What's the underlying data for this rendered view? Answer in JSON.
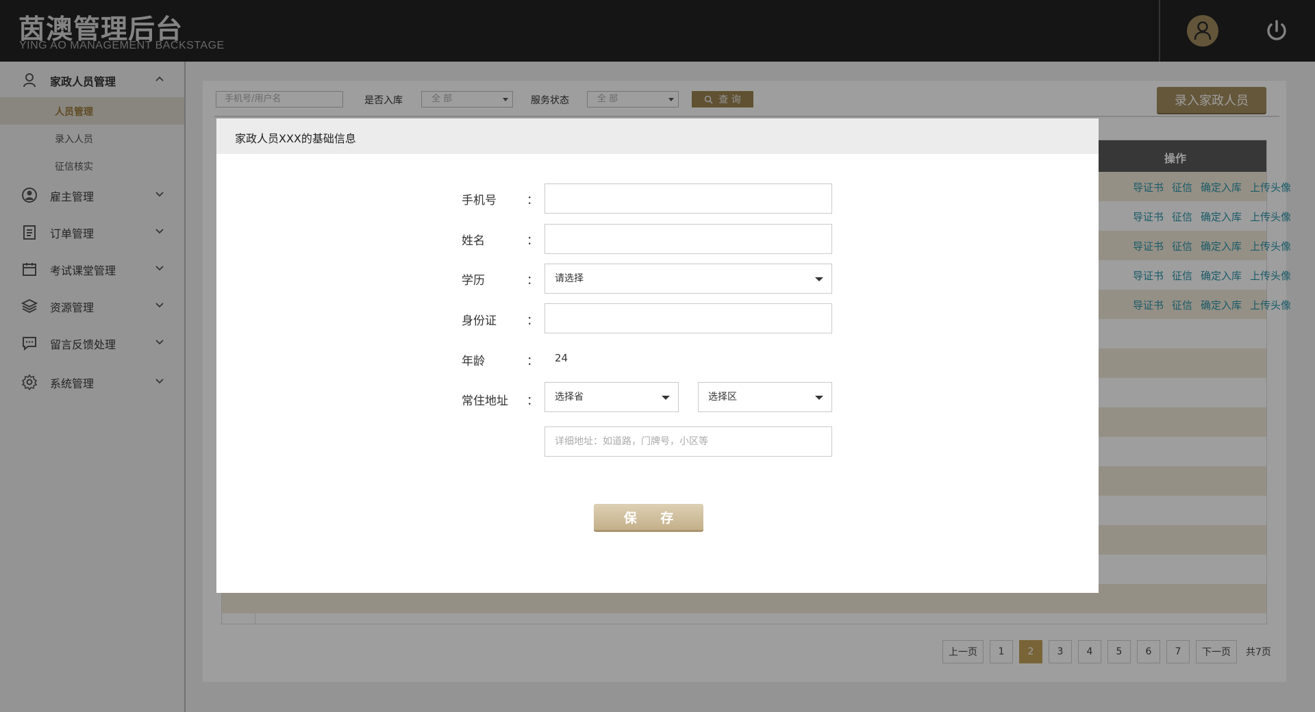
{
  "header": {
    "title": "茵澳管理后台",
    "subtitle": "YING AO MANAGEMENT BACKSTAGE"
  },
  "sidebar": {
    "groups": [
      {
        "label": "家政人员管理",
        "icon": "user-icon",
        "expanded": true,
        "items": [
          {
            "label": "人员管理",
            "active": true
          },
          {
            "label": "录入人员",
            "active": false
          },
          {
            "label": "征信核实",
            "active": false
          }
        ]
      },
      {
        "label": "雇主管理",
        "icon": "employer-icon",
        "expanded": false
      },
      {
        "label": "订单管理",
        "icon": "clipboard-icon",
        "expanded": false
      },
      {
        "label": "考试课堂管理",
        "icon": "calendar-icon",
        "expanded": false
      },
      {
        "label": "资源管理",
        "icon": "layers-icon",
        "expanded": false
      },
      {
        "label": "留言反馈处理",
        "icon": "message-icon",
        "expanded": false
      },
      {
        "label": "系统管理",
        "icon": "gear-icon",
        "expanded": false
      }
    ]
  },
  "toolbar": {
    "search_placeholder": "手机号/用户名",
    "in_storage_label": "是否入库",
    "in_storage_value": "全 部",
    "service_status_label": "服务状态",
    "service_status_value": "全 部",
    "query_label": "查 询",
    "add_button": "录入家政人员"
  },
  "table": {
    "header_ops": "操作",
    "row_ops": [
      "导证书",
      "征信",
      "确定入库",
      "上传头像"
    ],
    "visible_row_count": 5
  },
  "pagination": {
    "prev": "上一页",
    "pages": [
      "1",
      "2",
      "3",
      "4",
      "5",
      "6",
      "7"
    ],
    "current": "2",
    "next": "下一页",
    "total": "共7页"
  },
  "modal": {
    "title": "家政人员XXX的基础信息",
    "colon": "：",
    "fields": {
      "phone_label": "手机号",
      "name_label": "姓名",
      "education_label": "学历",
      "education_value": "请选择",
      "id_label": "身份证",
      "age_label": "年龄",
      "age_value": "24",
      "address_label": "常住地址",
      "province_value": "选择省",
      "district_value": "选择区",
      "address_placeholder": "详细地址：如道路，门牌号，小区等"
    },
    "save_label": "保 存"
  },
  "colors": {
    "header_bg": "#222222",
    "accent_gold": "#a48d5e",
    "link_teal": "#2a93a8",
    "table_head": "#595959"
  }
}
